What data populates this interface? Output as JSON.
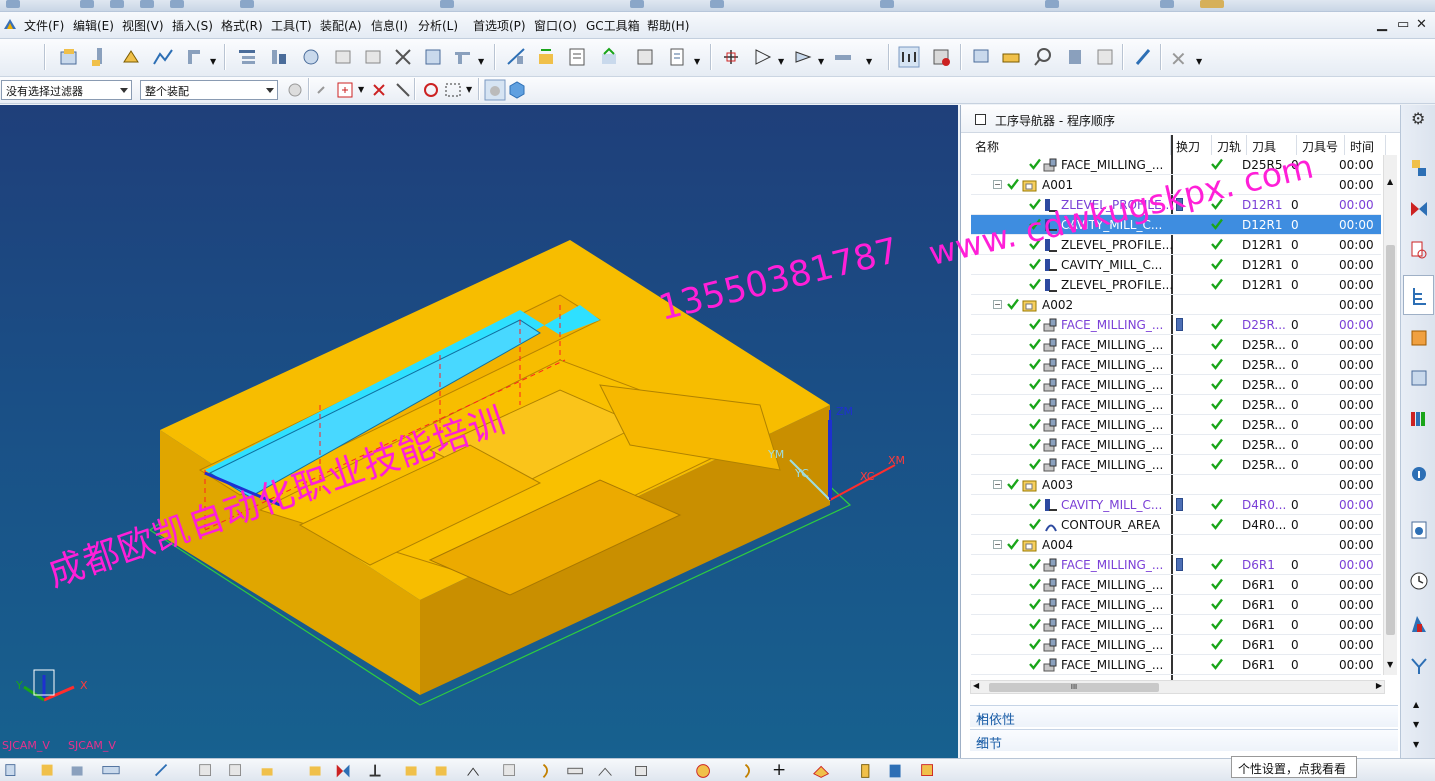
{
  "menubar": {
    "items": [
      "文件(F)",
      "编辑(E)",
      "视图(V)",
      "插入(S)",
      "格式(R)",
      "工具(T)",
      "装配(A)",
      "信息(I)",
      "分析(L)",
      "首选项(P)",
      "窗口(O)",
      "GC工具箱",
      "帮助(H)"
    ]
  },
  "filters": {
    "selection_filter": "没有选择过滤器",
    "assembly_scope": "整个装配"
  },
  "viewport": {
    "label_bottom_left": "SJCAM_V",
    "label_bottom_left2": "SJCAM_V",
    "axis_xm": "XM",
    "axis_xc": "XC",
    "axis_ym": "YM",
    "axis_yc": "YC",
    "axis_zm": "ZM",
    "triad_x": "X",
    "triad_y": "Y",
    "watermark_url": "www. cdwkugskpx. com",
    "watermark_phone": "13550381787",
    "watermark_cn": "成都欧凯自动化职业技能培训"
  },
  "navigator": {
    "title": "工序导航器 - 程序顺序",
    "columns": [
      "名称",
      "换刀",
      "刀轨",
      "刀具",
      "刀具号",
      "时间"
    ],
    "rows": [
      {
        "type": "op",
        "icon": "face",
        "name": "FACE_MILLING_...",
        "tool": "D25R5",
        "num": "0",
        "time": "00:00",
        "indent": 2,
        "chg": false
      },
      {
        "type": "group",
        "name": "A001",
        "time": "00:00",
        "indent": 1
      },
      {
        "type": "op",
        "icon": "zlevel",
        "name": "ZLEVEL_PROFILE...",
        "tool": "D12R1",
        "num": "0",
        "time": "00:00",
        "indent": 2,
        "chg": true,
        "purple": true
      },
      {
        "type": "op",
        "icon": "cavity",
        "name": "CAVITY_MILL_C...",
        "tool": "D12R1",
        "num": "0",
        "time": "00:00",
        "indent": 2,
        "chg": false,
        "selected": true
      },
      {
        "type": "op",
        "icon": "zlevel",
        "name": "ZLEVEL_PROFILE...",
        "tool": "D12R1",
        "num": "0",
        "time": "00:00",
        "indent": 2,
        "chg": false
      },
      {
        "type": "op",
        "icon": "cavity",
        "name": "CAVITY_MILL_C...",
        "tool": "D12R1",
        "num": "0",
        "time": "00:00",
        "indent": 2,
        "chg": false
      },
      {
        "type": "op",
        "icon": "zlevel",
        "name": "ZLEVEL_PROFILE...",
        "tool": "D12R1",
        "num": "0",
        "time": "00:00",
        "indent": 2,
        "chg": false
      },
      {
        "type": "group",
        "name": "A002",
        "time": "00:00",
        "indent": 1
      },
      {
        "type": "op",
        "icon": "face",
        "name": "FACE_MILLING_...",
        "tool": "D25R...",
        "num": "0",
        "time": "00:00",
        "indent": 2,
        "chg": true,
        "purple": true
      },
      {
        "type": "op",
        "icon": "face",
        "name": "FACE_MILLING_...",
        "tool": "D25R...",
        "num": "0",
        "time": "00:00",
        "indent": 2,
        "chg": false
      },
      {
        "type": "op",
        "icon": "face",
        "name": "FACE_MILLING_...",
        "tool": "D25R...",
        "num": "0",
        "time": "00:00",
        "indent": 2,
        "chg": false
      },
      {
        "type": "op",
        "icon": "face",
        "name": "FACE_MILLING_...",
        "tool": "D25R...",
        "num": "0",
        "time": "00:00",
        "indent": 2,
        "chg": false
      },
      {
        "type": "op",
        "icon": "face",
        "name": "FACE_MILLING_...",
        "tool": "D25R...",
        "num": "0",
        "time": "00:00",
        "indent": 2,
        "chg": false
      },
      {
        "type": "op",
        "icon": "face",
        "name": "FACE_MILLING_...",
        "tool": "D25R...",
        "num": "0",
        "time": "00:00",
        "indent": 2,
        "chg": false
      },
      {
        "type": "op",
        "icon": "face",
        "name": "FACE_MILLING_...",
        "tool": "D25R...",
        "num": "0",
        "time": "00:00",
        "indent": 2,
        "chg": false
      },
      {
        "type": "op",
        "icon": "face",
        "name": "FACE_MILLING_...",
        "tool": "D25R...",
        "num": "0",
        "time": "00:00",
        "indent": 2,
        "chg": false
      },
      {
        "type": "group",
        "name": "A003",
        "time": "00:00",
        "indent": 1
      },
      {
        "type": "op",
        "icon": "cavity",
        "name": "CAVITY_MILL_C...",
        "tool": "D4R0...",
        "num": "0",
        "time": "00:00",
        "indent": 2,
        "chg": true,
        "purple": true
      },
      {
        "type": "op",
        "icon": "contour",
        "name": "CONTOUR_AREA",
        "tool": "D4R0...",
        "num": "0",
        "time": "00:00",
        "indent": 2,
        "chg": false
      },
      {
        "type": "group",
        "name": "A004",
        "time": "00:00",
        "indent": 1
      },
      {
        "type": "op",
        "icon": "face",
        "name": "FACE_MILLING_...",
        "tool": "D6R1",
        "num": "0",
        "time": "00:00",
        "indent": 2,
        "chg": true,
        "purple": true
      },
      {
        "type": "op",
        "icon": "face",
        "name": "FACE_MILLING_...",
        "tool": "D6R1",
        "num": "0",
        "time": "00:00",
        "indent": 2,
        "chg": false
      },
      {
        "type": "op",
        "icon": "face",
        "name": "FACE_MILLING_...",
        "tool": "D6R1",
        "num": "0",
        "time": "00:00",
        "indent": 2,
        "chg": false
      },
      {
        "type": "op",
        "icon": "face",
        "name": "FACE_MILLING_...",
        "tool": "D6R1",
        "num": "0",
        "time": "00:00",
        "indent": 2,
        "chg": false
      },
      {
        "type": "op",
        "icon": "face",
        "name": "FACE_MILLING_...",
        "tool": "D6R1",
        "num": "0",
        "time": "00:00",
        "indent": 2,
        "chg": false
      },
      {
        "type": "op",
        "icon": "face",
        "name": "FACE_MILLING_...",
        "tool": "D6R1",
        "num": "0",
        "time": "00:00",
        "indent": 2,
        "chg": false
      }
    ],
    "hscroll_mark": "III",
    "section_dependencies": "相依性",
    "section_details": "细节"
  },
  "tooltip": "个性设置，点我看看",
  "colors": {
    "accent_selection": "#3e8de0",
    "part_yellow": "#f5bb00",
    "watermark": "#ff1fd8",
    "check_green": "#1aa51a",
    "purple_text": "#7a3fd6"
  }
}
